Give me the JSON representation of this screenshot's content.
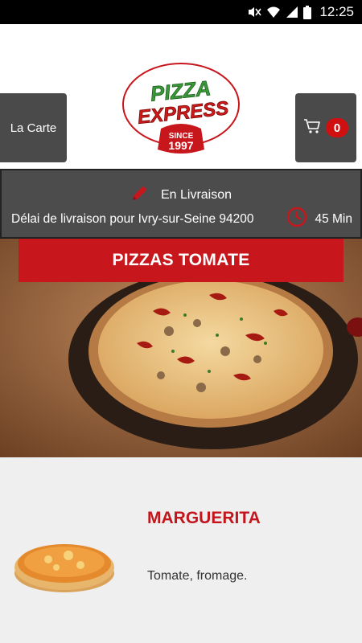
{
  "status_bar": {
    "time": "12:25"
  },
  "header": {
    "menu_button_label": "La Carte",
    "cart_count": "0",
    "logo": {
      "line1": "PIZZA",
      "line2": "EXPRESS",
      "badge_line1": "SINCE",
      "badge_line2": "1997"
    }
  },
  "delivery": {
    "mode": "En Livraison",
    "delay_text": "Délai de livraison pour Ivry-sur-Seine 94200",
    "delay_value": "45 Min"
  },
  "category": {
    "title": "PIZZAS TOMATE"
  },
  "product": {
    "name": "MARGUERITA",
    "description": "Tomate, fromage."
  },
  "colors": {
    "brand_red": "#c8161d",
    "panel_gray": "#4a4a4a"
  }
}
